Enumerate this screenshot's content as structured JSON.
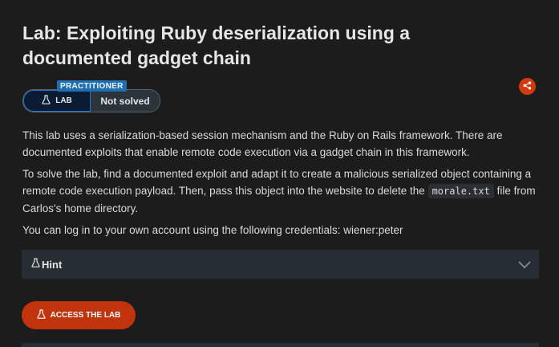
{
  "lab": {
    "title": "Lab: Exploiting Ruby deserialization using a documented gadget chain",
    "level": "PRACTITIONER",
    "lab_label": "LAB",
    "status": "Not solved",
    "share_icon": "share-icon",
    "description": {
      "p1": "This lab uses a serialization-based session mechanism and the Ruby on Rails framework. There are documented exploits that enable remote code execution via a gadget chain in this framework.",
      "p2_before": "To solve the lab, find a documented exploit and adapt it to create a malicious serialized object containing a remote code execution payload. Then, pass this object into the website to delete the ",
      "p2_code": "morale.txt",
      "p2_after": " file from Carlos's home directory.",
      "p3": "You can log in to your own account using the following credentials: wiener:peter"
    },
    "hint_label": "Hint",
    "access_button": "ACCESS THE LAB"
  },
  "colors": {
    "background": "#1c1c1c",
    "accent_orange": "#c1330c",
    "level_blue": "#1f6fb0",
    "panel": "#262d33"
  }
}
